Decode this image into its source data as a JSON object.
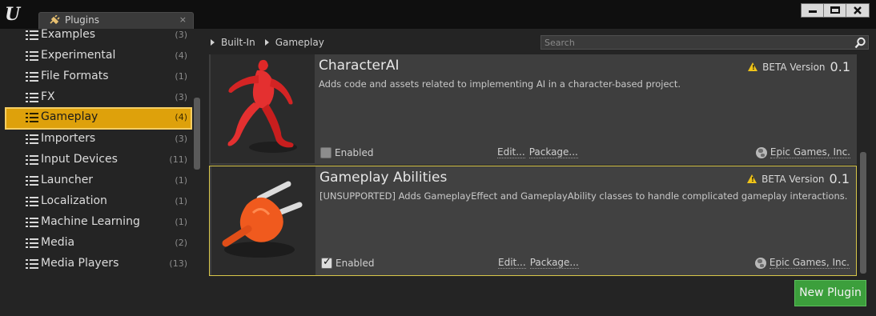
{
  "window": {
    "tab_title": "Plugins",
    "tab_close": "×"
  },
  "sidebar": {
    "items": [
      {
        "label": "Examples",
        "count": "(3)"
      },
      {
        "label": "Experimental",
        "count": "(4)"
      },
      {
        "label": "File Formats",
        "count": "(1)"
      },
      {
        "label": "FX",
        "count": "(3)"
      },
      {
        "label": "Gameplay",
        "count": "(4)",
        "selected": true
      },
      {
        "label": "Importers",
        "count": "(3)"
      },
      {
        "label": "Input Devices",
        "count": "(11)"
      },
      {
        "label": "Launcher",
        "count": "(1)"
      },
      {
        "label": "Localization",
        "count": "(1)"
      },
      {
        "label": "Machine Learning",
        "count": "(1)"
      },
      {
        "label": "Media",
        "count": "(2)"
      },
      {
        "label": "Media Players",
        "count": "(13)"
      }
    ]
  },
  "breadcrumb": [
    "Built-In",
    "Gameplay"
  ],
  "search": {
    "placeholder": "Search",
    "value": ""
  },
  "plugins": [
    {
      "name": "CharacterAI",
      "description": "Adds code and assets related to implementing AI in a character-based project.",
      "badge": "BETA Version",
      "version": "0.1",
      "enabled_label": "Enabled",
      "enabled": false,
      "edit_label": "Edit...",
      "package_label": "Package...",
      "vendor": "Epic Games, Inc."
    },
    {
      "name": "Gameplay Abilities",
      "description": "[UNSUPPORTED] Adds GameplayEffect and GameplayAbility classes to handle complicated gameplay interactions.",
      "badge": "BETA Version",
      "version": "0.1",
      "enabled_label": "Enabled",
      "enabled": true,
      "edit_label": "Edit...",
      "package_label": "Package...",
      "vendor": "Epic Games, Inc."
    }
  ],
  "new_plugin_label": "New Plugin",
  "icons": {
    "logo": "unreal-logo-icon",
    "category": "list-icon",
    "search": "search-icon",
    "warning": "warning-icon",
    "vendor": "globe-icon"
  }
}
